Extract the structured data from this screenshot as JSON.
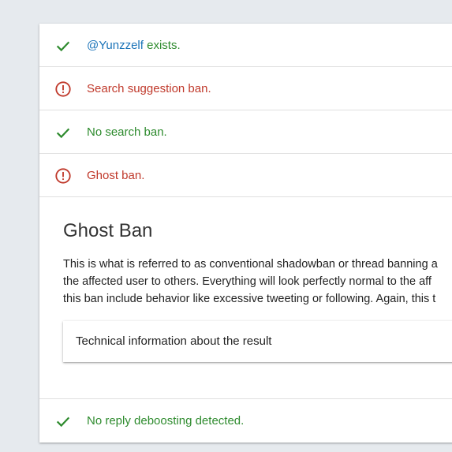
{
  "results": {
    "exists": {
      "handle": "@Yunzzelf",
      "suffix": " exists.",
      "status": "ok"
    },
    "search_suggestion": {
      "label": "Search suggestion ban.",
      "status": "bad"
    },
    "search_ban": {
      "label": "No search ban.",
      "status": "ok"
    },
    "ghost_ban": {
      "label": "Ghost ban.",
      "status": "bad"
    },
    "reply_deboosting": {
      "label": "No reply deboosting detected.",
      "status": "ok"
    }
  },
  "ghost_ban_detail": {
    "title": "Ghost Ban",
    "lines": [
      "This is what is referred to as conventional shadowban or thread banning a",
      "the affected user to others. Everything will look perfectly normal to the aff",
      "this ban include behavior like excessive tweeting or following. Again, this t"
    ],
    "technical_info_label": "Technical information about the result"
  },
  "colors": {
    "ok": "#2e8b2e",
    "bad": "#c0392b",
    "link": "#1a73b8",
    "background": "#e6eaee"
  },
  "icons": {
    "ok": "check-icon",
    "bad": "alert-circle-icon"
  }
}
